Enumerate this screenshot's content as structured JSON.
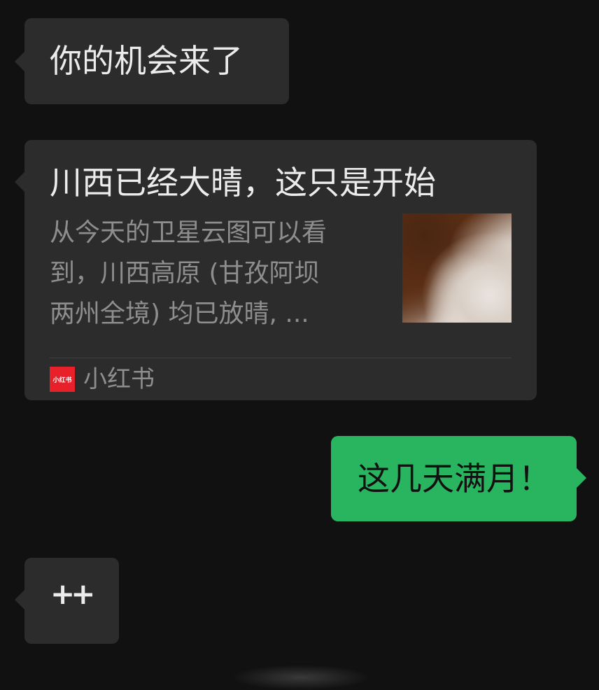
{
  "messages": [
    {
      "direction": "incoming",
      "text": "你的机会来了"
    },
    {
      "direction": "incoming",
      "type": "link-card",
      "title": "川西已经大晴，这只是开始",
      "description_lines": [
        "从今天的卫星云图可以看",
        "到，川西高原 (甘孜阿坝",
        "两州全境) 均已放晴, ..."
      ],
      "source_icon_text": "小红书",
      "source_name": "小红书"
    },
    {
      "direction": "outgoing",
      "text": "这几天满月！"
    },
    {
      "direction": "incoming",
      "text": "++"
    }
  ],
  "colors": {
    "background": "#111111",
    "incoming_bubble": "#2c2c2c",
    "outgoing_bubble": "#29b560",
    "source_brand": "#e8202a"
  }
}
